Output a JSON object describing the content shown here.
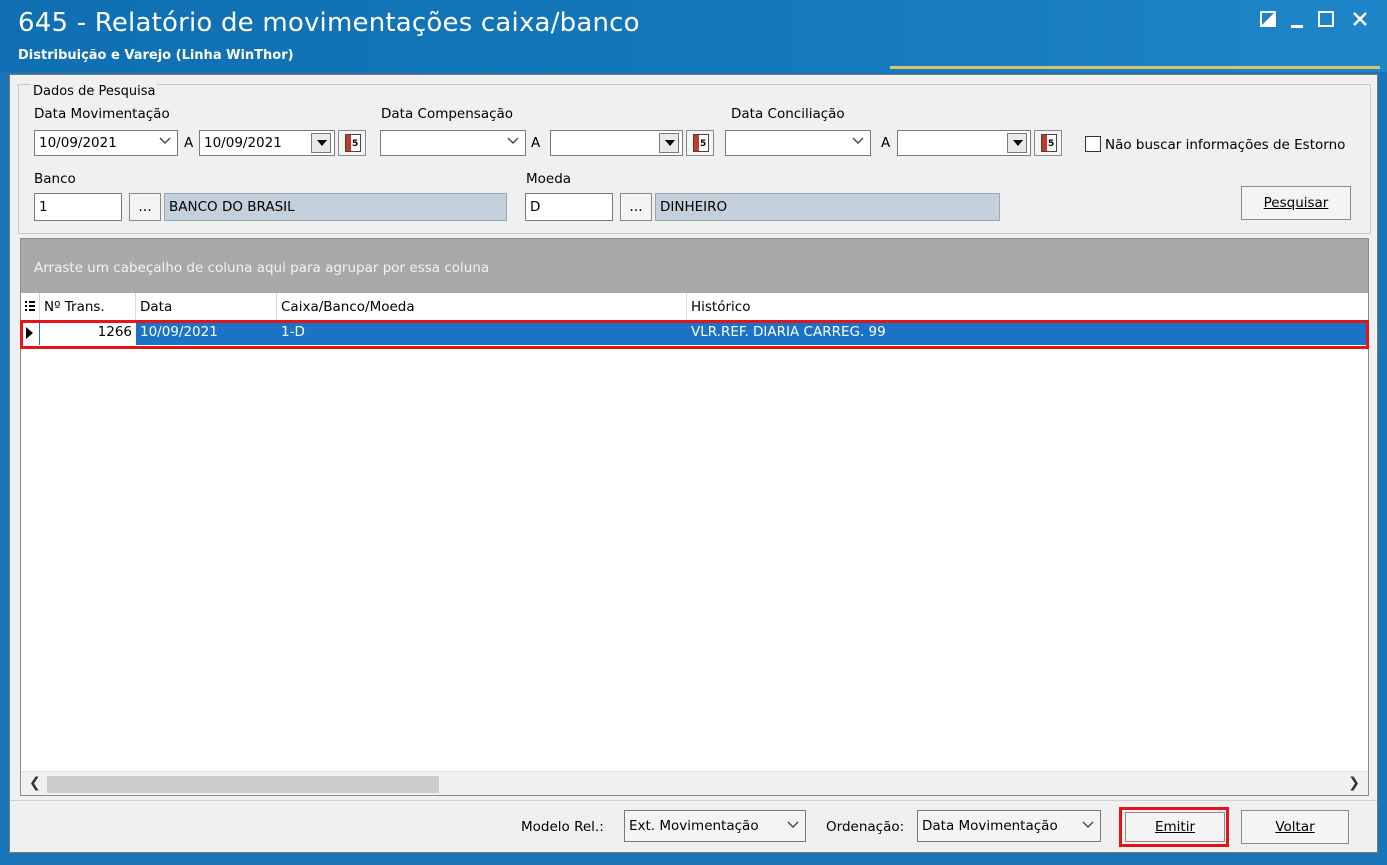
{
  "window": {
    "title": "645 - Relatório de movimentações caixa/banco",
    "subtitle": "Distribuição e Varejo (Linha WinThor)"
  },
  "search": {
    "group_title": "Dados de Pesquisa",
    "data_movimentacao": {
      "label": "Data Movimentação",
      "from": "10/09/2021",
      "sep": "A",
      "to": "10/09/2021"
    },
    "data_compensacao": {
      "label": "Data Compensação",
      "from": "",
      "sep": "A",
      "to": ""
    },
    "data_conciliacao": {
      "label": "Data Conciliação",
      "from": "",
      "sep": "A",
      "to": ""
    },
    "calendar_number": "5",
    "nao_buscar_estorno": {
      "label": "Não buscar informações de Estorno",
      "checked": false
    },
    "banco": {
      "label": "Banco",
      "code": "1",
      "ellipsis": "...",
      "name": "BANCO DO BRASIL"
    },
    "moeda": {
      "label": "Moeda",
      "code": "D",
      "ellipsis": "...",
      "name": "DINHEIRO"
    },
    "pesquisar_label": "Pesquisar"
  },
  "grid": {
    "group_panel_text": "Arraste um cabeçalho de coluna aqui para agrupar por essa coluna",
    "columns": [
      "Nº Trans.",
      "Data",
      "Caixa/Banco/Moeda",
      "Histórico"
    ],
    "rows": [
      {
        "num_trans": "1266",
        "data": "10/09/2021",
        "caixa_banco_moeda": "1-D",
        "historico": "VLR.REF. DIARIA CARREG. 99"
      }
    ]
  },
  "footer": {
    "modelo_label": "Modelo Rel.:",
    "modelo_value": "Ext. Movimentação",
    "ordenacao_label": "Ordenação:",
    "ordenacao_value": "Data Movimentação",
    "emitir_label": "Emitir",
    "voltar_label": "Voltar"
  },
  "colors": {
    "titlebar": "#1478bc",
    "selection": "#1b73c7",
    "highlight": "#e3151a",
    "readonly_field": "#c4d0dc",
    "group_panel": "#a9a9a9"
  },
  "icons": {
    "restore": "restore-icon",
    "minimize": "minimize-icon",
    "maximize": "maximize-icon",
    "close": "close-icon",
    "calendar": "calendar-icon",
    "dropdown": "chevron-down-icon",
    "row_indicator": "row-indicator-arrow-icon",
    "column_chooser": "column-chooser-icon"
  }
}
